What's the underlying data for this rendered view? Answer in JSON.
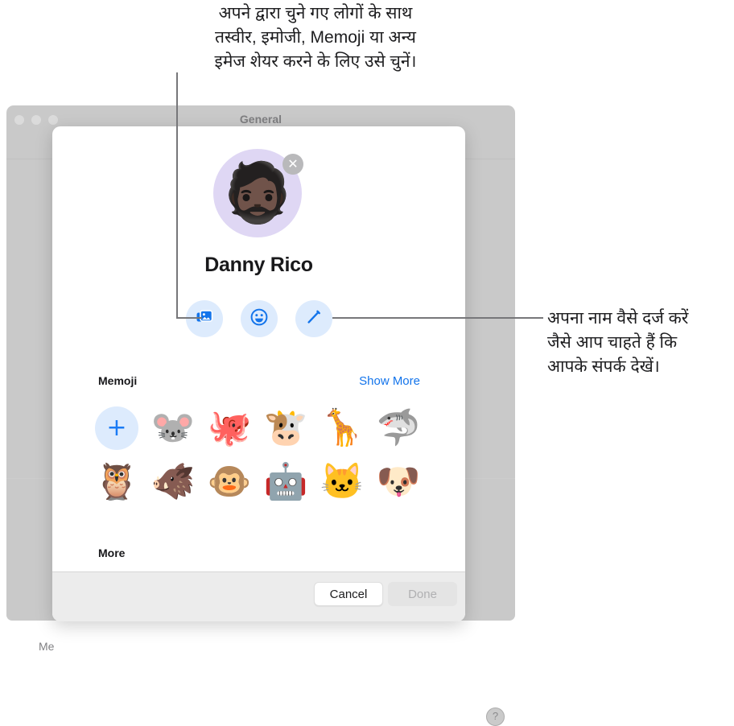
{
  "callouts": {
    "top": "अपने द्वारा चुने गए लोगों के साथ\nतस्वीर, इमोजी, Memoji या अन्य\nइमेज शेयर करने के लिए उसे चुनें।",
    "right": "अपना नाम वैसे दर्ज करें\nजैसे आप चाहते हैं कि\nआपके संपर्क देखें।"
  },
  "background_window": {
    "title": "General",
    "partial_label": "Me",
    "help_label": "?",
    "traffic_lights": [
      "close",
      "minimize",
      "maximize"
    ]
  },
  "sheet": {
    "avatar": {
      "art": "🧔🏿",
      "remove_label": "✕",
      "background_color": "#dfd7f4"
    },
    "display_name": "Danny Rico",
    "actions": [
      {
        "name": "photos",
        "glyph": "photos-icon"
      },
      {
        "name": "emoji",
        "glyph": "emoji-icon"
      },
      {
        "name": "edit",
        "glyph": "pencil-icon"
      }
    ],
    "memoji_section": {
      "title": "Memoji",
      "show_more_label": "Show More",
      "rows": [
        [
          {
            "name": "add-memoji",
            "glyph": "+"
          },
          {
            "name": "mouse",
            "glyph": "🐭"
          },
          {
            "name": "octopus",
            "glyph": "🐙"
          },
          {
            "name": "cow",
            "glyph": "🐮"
          },
          {
            "name": "giraffe",
            "glyph": "🦒"
          },
          {
            "name": "shark",
            "glyph": "🦈"
          }
        ],
        [
          {
            "name": "owl",
            "glyph": "🦉"
          },
          {
            "name": "boar",
            "glyph": "🐗"
          },
          {
            "name": "monkey",
            "glyph": "🐵"
          },
          {
            "name": "robot",
            "glyph": "🤖"
          },
          {
            "name": "cat",
            "glyph": "🐱"
          },
          {
            "name": "dog",
            "glyph": "🐶"
          }
        ]
      ]
    },
    "more_section": {
      "title": "More"
    },
    "footer": {
      "cancel_label": "Cancel",
      "done_label": "Done",
      "done_enabled": false
    }
  },
  "colors": {
    "accent_blue": "#1374eb",
    "action_button_bg": "#ddebfd",
    "window_chrome": "#c9c9c9",
    "footer_bg": "#ececec"
  }
}
